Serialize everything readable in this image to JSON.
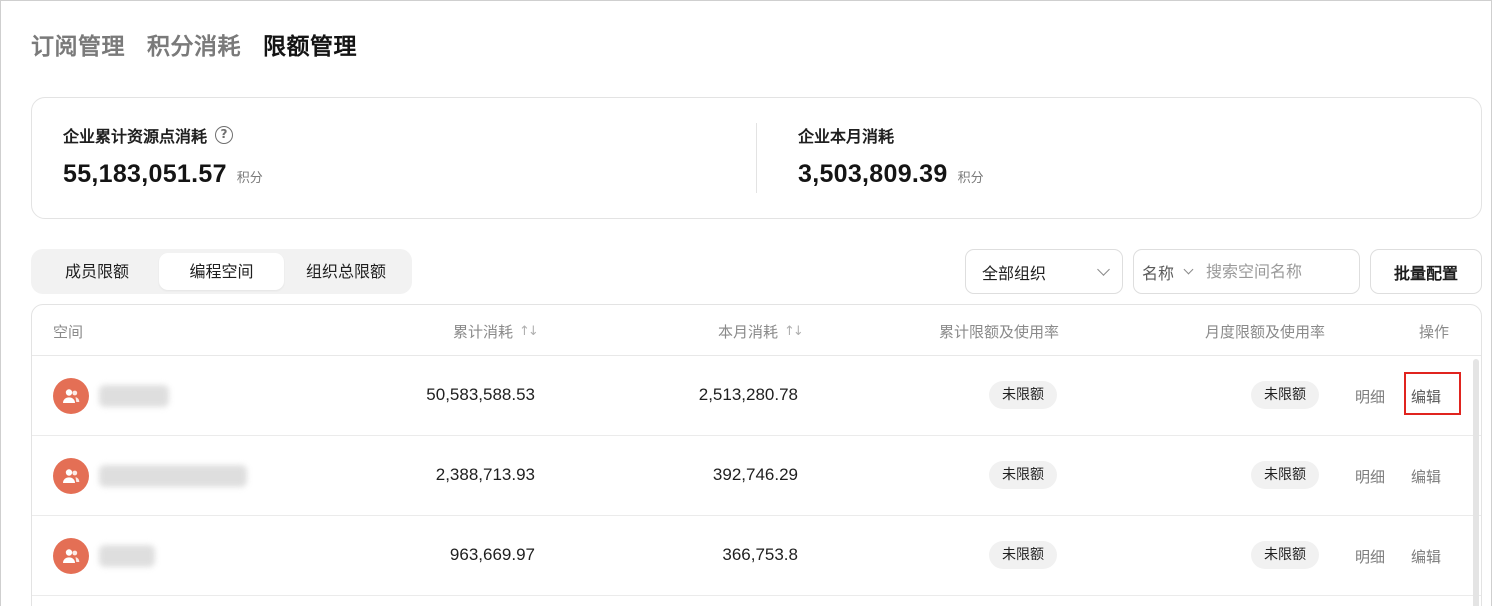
{
  "top_tabs": [
    {
      "label": "订阅管理"
    },
    {
      "label": "积分消耗"
    },
    {
      "label": "限额管理"
    }
  ],
  "summary": {
    "total": {
      "label": "企业累计资源点消耗",
      "value": "55,183,051.57",
      "unit": "积分",
      "help_icon": "question-circle-icon"
    },
    "month": {
      "label": "企业本月消耗",
      "value": "3,503,809.39",
      "unit": "积分"
    }
  },
  "segments": [
    {
      "label": "成员限额"
    },
    {
      "label": "编程空间",
      "active": true
    },
    {
      "label": "组织总限额"
    }
  ],
  "filters": {
    "org_select": "全部组织",
    "search_field": "名称",
    "search_placeholder": "搜索空间名称",
    "batch_button": "批量配置"
  },
  "table": {
    "columns": [
      "空间",
      "累计消耗",
      "本月消耗",
      "累计限额及使用率",
      "月度限额及使用率",
      "操作"
    ],
    "rows": [
      {
        "total": "50,583,588.53",
        "month": "2,513,280.78",
        "total_limit": "未限额",
        "month_limit": "未限额",
        "detail": "明细",
        "edit": "编辑"
      },
      {
        "total": "2,388,713.93",
        "month": "392,746.29",
        "total_limit": "未限额",
        "month_limit": "未限额",
        "detail": "明细",
        "edit": "编辑"
      },
      {
        "total": "963,669.97",
        "month": "366,753.8",
        "total_limit": "未限额",
        "month_limit": "未限额",
        "detail": "明细",
        "edit": "编辑"
      }
    ]
  },
  "colors": {
    "avatar": "#e46f55",
    "highlight_border": "#e0241f"
  }
}
